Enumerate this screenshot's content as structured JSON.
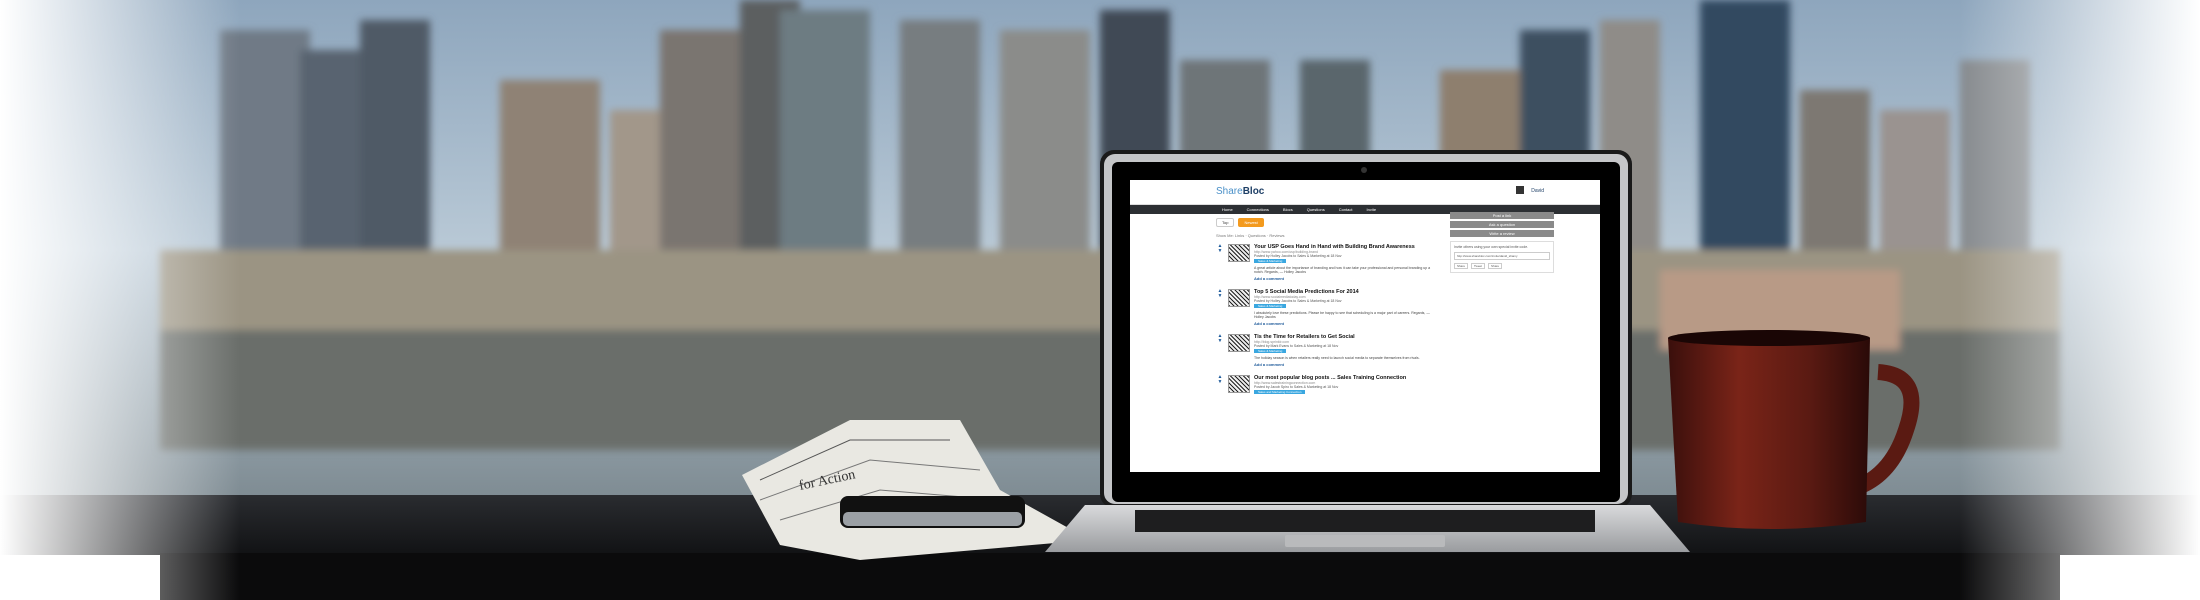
{
  "app": {
    "logo_share": "Share",
    "logo_bloc": "Bloc",
    "user_name": "David"
  },
  "nav": {
    "items": [
      "Home",
      "Connections",
      "Blocs",
      "Questions",
      "Contact",
      "Invite"
    ]
  },
  "toggle": {
    "top": "Top",
    "newest": "Newest"
  },
  "show_me": "Show Me: Links · Questions · Reviews",
  "posts": [
    {
      "title": "Your USP Goes Hand in Hand with Building Brand Awareness",
      "url": "http://www.yahoo.com/usp/building-brand",
      "meta": "Posted by Holley Jacobs to Sales & Marketing at 18 Nov",
      "tag": "Sales & Marketing",
      "text": "A great article about the importance of branding and how it can take your professional and personal branding up a notch. Regards, — Holley Jacobs",
      "comment": "Add a comment"
    },
    {
      "title": "Top 5 Social Media Predictions For 2014",
      "url": "http://www.socialmediatoday.com",
      "meta": "Posted by Holley Jacobs to Sales & Marketing at 18 Nov",
      "tag": "Sales & Marketing",
      "text": "I absolutely love these predictions. Please be happy to see that scheduling is a major part of careers. Regards, — Holley Jacobs",
      "comment": "Add a comment"
    },
    {
      "title": "Tis the Time for Retailers to Get Social",
      "url": "http://blog.sprinklr.com",
      "meta": "Posted by Mark Evans to Sales & Marketing at 18 Nov",
      "tag": "Sales & Marketing",
      "text": "The holiday season is when retailers really need to launch social media to separate themselves from rivals.",
      "comment": "Add a comment"
    },
    {
      "title": "Our most popular blog posts ... Sales Training Connection",
      "url": "http://www.salestrainingconnection.com",
      "meta": "Posted by Jacob Spiro to Sales & Marketing at 18 Nov",
      "tag": "Sales and Marketing Connection",
      "text": "",
      "comment": ""
    }
  ],
  "sidebar": {
    "buttons": [
      "Post a link",
      "Ask a question",
      "Write a review"
    ],
    "invite_text": "Invite others using your own special invite code.",
    "invite_url": "http://www.sharebloc.com/invite/david_shamy",
    "social_buttons": [
      "Share",
      "Tweet",
      "Share"
    ]
  }
}
